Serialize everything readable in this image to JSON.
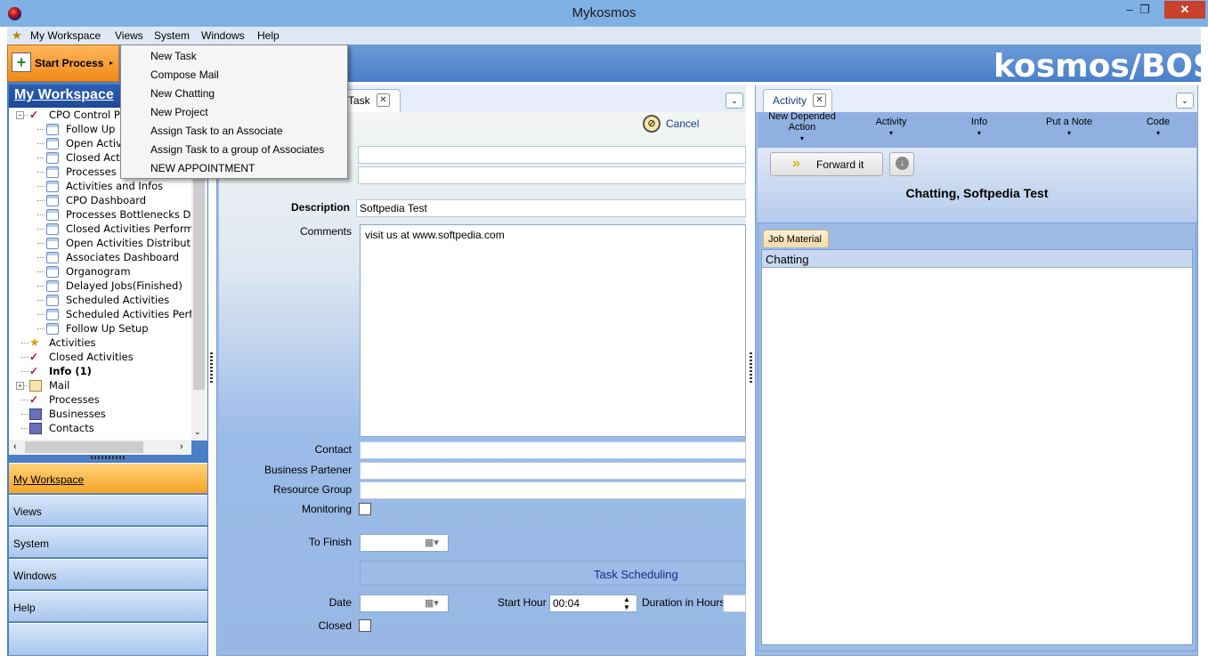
{
  "window": {
    "title": "Mykosmos",
    "minimize": "–",
    "maximize": "❐",
    "close": "✕"
  },
  "menubar": {
    "items": [
      "My Workspace",
      "Views",
      "System",
      "Windows",
      "Help"
    ]
  },
  "banner": {
    "brand": "kosmos/BOS",
    "start_process": "Start Process",
    "start_arrow": "▸"
  },
  "dropdown": {
    "items": [
      "New Task",
      "Compose Mail",
      "New Chatting",
      "New Project",
      "Assign Task to an Associate",
      "Assign Task to a group of Associates",
      "NEW APPOINTMENT"
    ]
  },
  "left": {
    "header": "My Workspace",
    "tree": [
      {
        "label": "CPO Control P",
        "icon": "check",
        "bold": false
      },
      {
        "label": "Follow Up",
        "icon": "doc"
      },
      {
        "label": "Open Activi",
        "icon": "doc"
      },
      {
        "label": "Closed Acti",
        "icon": "doc"
      },
      {
        "label": "Processes",
        "icon": "doc"
      },
      {
        "label": "Activities and Infos",
        "icon": "doc"
      },
      {
        "label": "CPO Dashboard",
        "icon": "doc"
      },
      {
        "label": "Processes Bottlenecks D",
        "icon": "doc"
      },
      {
        "label": "Closed Activities Perform",
        "icon": "doc"
      },
      {
        "label": "Open Activities Distributi",
        "icon": "doc"
      },
      {
        "label": "Associates Dashboard",
        "icon": "doc"
      },
      {
        "label": "Organogram",
        "icon": "doc"
      },
      {
        "label": "Delayed Jobs(Finished)",
        "icon": "doc"
      },
      {
        "label": "Scheduled Activities",
        "icon": "doc"
      },
      {
        "label": "Scheduled Activities Perf",
        "icon": "doc"
      },
      {
        "label": "Follow Up Setup",
        "icon": "doc"
      },
      {
        "label": "Activities",
        "icon": "star"
      },
      {
        "label": "Closed Activities",
        "icon": "check"
      },
      {
        "label": "Info (1)",
        "icon": "check",
        "bold": true
      },
      {
        "label": "Mail",
        "icon": "mail"
      },
      {
        "label": "Processes",
        "icon": "check"
      },
      {
        "label": "Businesses",
        "icon": "biz"
      },
      {
        "label": "Contacts",
        "icon": "biz"
      }
    ],
    "nav": [
      "My Workspace",
      "Views",
      "System",
      "Windows",
      "Help"
    ]
  },
  "center": {
    "tab": "Task",
    "cancel": "Cancel",
    "labels": {
      "description": "Description",
      "comments": "Comments",
      "contact": "Contact",
      "business": "Business Partener",
      "resource": "Resource Group",
      "monitoring": "Monitoring",
      "to_finish": "To Finish",
      "scheduling": "Task Scheduling",
      "date": "Date",
      "start_hour": "Start Hour",
      "duration": "Duration in Hours",
      "closed": "Closed"
    },
    "values": {
      "description": "Softpedia Test",
      "comments": "visit us at www.softpedia.com",
      "start_hour": "00:04"
    }
  },
  "right": {
    "tab": "Activity",
    "actions": [
      "New Depended Action",
      "Activity",
      "Info",
      "Put a Note",
      "Code"
    ],
    "forward": "Forward it",
    "subject": "Chatting, Softpedia Test",
    "job_tab": "Job Material",
    "job_header": "Chatting"
  },
  "colors": {
    "accent_orange": "#f5a526",
    "panel_blue": "#9cbbe6",
    "header_blue": "#1d4898"
  }
}
